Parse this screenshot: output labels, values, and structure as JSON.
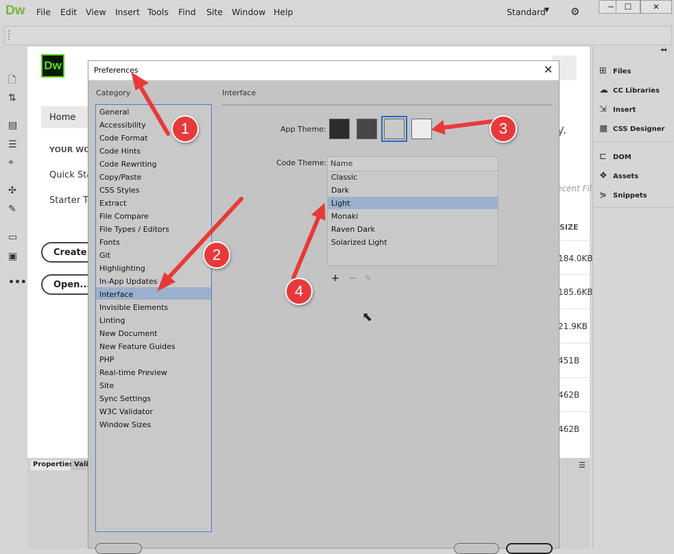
{
  "app": {
    "logo": "Dw",
    "menu": [
      "File",
      "Edit",
      "View",
      "Insert",
      "Tools",
      "Find",
      "Site",
      "Window",
      "Help"
    ],
    "workspace": "Standard",
    "window_buttons": [
      "─",
      "☐",
      "✕"
    ]
  },
  "left_toolbar": {
    "icons": [
      "file-icon",
      "file-transfer-icon",
      "code-inspect-icon",
      "indent-icon",
      "target-icon",
      "dom-tools-icon",
      "brush-icon",
      "comment-icon",
      "format-icon",
      "more-icon"
    ]
  },
  "start_screen": {
    "logo": "Dw",
    "home": "Home",
    "your_work": "YOUR WOR",
    "quick_start": "Quick Star",
    "starter_templates": "Starter Ter",
    "create_new": "Create N",
    "open": "Open...",
    "partial_heading": "y.",
    "recent_files": "ecent Fil",
    "size_header": "SIZE",
    "sizes": [
      "184.0KB",
      "185.6KB",
      "21.9KB",
      "451B",
      "462B",
      "462B"
    ]
  },
  "properties_panel": {
    "tabs": [
      "Properties",
      "Vali"
    ]
  },
  "right_panel": {
    "items": [
      {
        "label": "Files",
        "icon": "files-icon"
      },
      {
        "label": "CC Libraries",
        "icon": "cc-libraries-icon"
      },
      {
        "label": "Insert",
        "icon": "insert-icon"
      },
      {
        "label": "CSS Designer",
        "icon": "css-designer-icon"
      },
      {
        "label": "DOM",
        "icon": "dom-icon"
      },
      {
        "label": "Assets",
        "icon": "assets-icon"
      },
      {
        "label": "Snippets",
        "icon": "snippets-icon"
      }
    ]
  },
  "preferences": {
    "title": "Preferences",
    "category_label": "Category",
    "categories": [
      "General",
      "Accessibility",
      "Code Format",
      "Code Hints",
      "Code Rewriting",
      "Copy/Paste",
      "CSS Styles",
      "Extract",
      "File Compare",
      "File Types / Editors",
      "Fonts",
      "Git",
      "Highlighting",
      "In-App Updates",
      "Interface",
      "Invisible Elements",
      "Linting",
      "New Document",
      "New Feature Guides",
      "PHP",
      "Real-time Preview",
      "Site",
      "Sync Settings",
      "W3C Validator",
      "Window Sizes"
    ],
    "selected_category": "Interface",
    "section_title": "Interface",
    "app_theme_label": "App Theme:",
    "app_theme_colors": [
      "#2c2c2c",
      "#474747",
      "#c8c8c8",
      "#ededed"
    ],
    "selected_app_theme_index": 2,
    "code_theme_label": "Code Theme:",
    "code_theme_header": "Name",
    "code_themes": [
      "Classic",
      "Dark",
      "Light",
      "Monaki",
      "Raven Dark",
      "Solarized Light"
    ],
    "selected_code_theme": "Light"
  },
  "annotations": {
    "badges": [
      "1",
      "2",
      "3",
      "4"
    ],
    "color": "#e8393a"
  }
}
